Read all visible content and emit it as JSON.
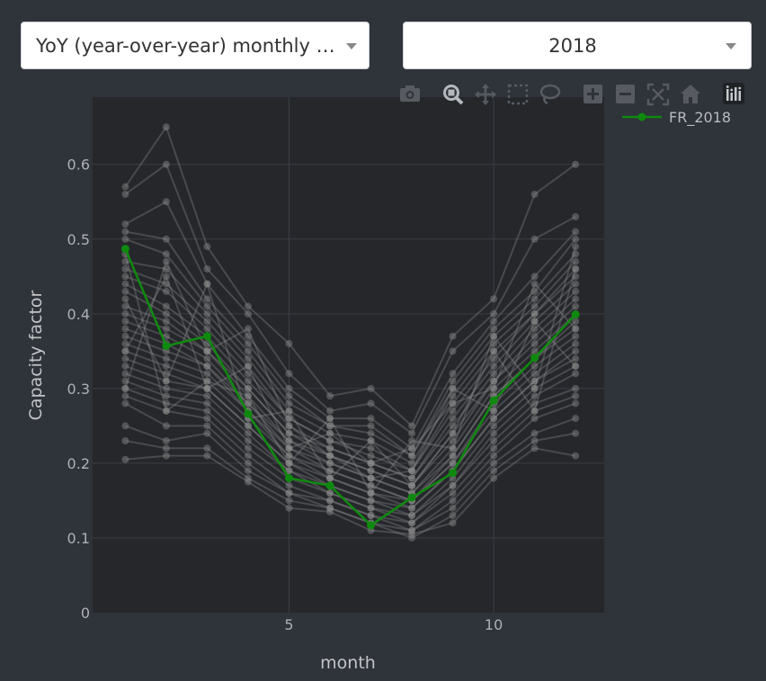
{
  "controls": {
    "metric_dropdown": {
      "selected": "YoY (year-over-year) monthly capacity factor"
    },
    "year_dropdown": {
      "selected": "2018"
    }
  },
  "modebar": {
    "buttons": [
      "camera-icon",
      "zoom-icon",
      "pan-icon",
      "box-select-icon",
      "lasso-icon",
      "zoom-in-icon",
      "zoom-out-icon",
      "autoscale-icon",
      "home-icon",
      "plotly-logo-icon"
    ]
  },
  "colors": {
    "page_bg": "#2f333a",
    "plot_bg": "#25272b",
    "highlight": "#0f8a0f",
    "background_series": "#8c8c8c"
  },
  "chart_data": {
    "type": "line",
    "xlabel": "month",
    "ylabel": "Capacity factor",
    "x": [
      1,
      2,
      3,
      4,
      5,
      6,
      7,
      8,
      9,
      10,
      11,
      12
    ],
    "xlim": [
      0.2,
      12.7
    ],
    "ylim": [
      0,
      0.69
    ],
    "xticks": [
      5,
      10
    ],
    "yticks": [
      0,
      0.1,
      0.2,
      0.3,
      0.4,
      0.5,
      0.6
    ],
    "ytick_labels": [
      "0",
      "0.1",
      "0.2",
      "0.3",
      "0.4",
      "0.5",
      "0.6"
    ],
    "grid": true,
    "legend": {
      "placement": "top-right",
      "entries": [
        "FR_2018"
      ]
    },
    "highlight_series": {
      "name": "FR_2018",
      "values": [
        0.487,
        0.357,
        0.37,
        0.266,
        0.18,
        0.17,
        0.117,
        0.154,
        0.187,
        0.284,
        0.341,
        0.399
      ]
    },
    "background_series": [
      [
        0.57,
        0.65,
        0.49,
        0.41,
        0.36,
        0.29,
        0.3,
        0.25,
        0.37,
        0.42,
        0.56,
        0.6
      ],
      [
        0.56,
        0.6,
        0.46,
        0.4,
        0.32,
        0.27,
        0.28,
        0.24,
        0.35,
        0.4,
        0.5,
        0.53
      ],
      [
        0.52,
        0.55,
        0.44,
        0.37,
        0.3,
        0.26,
        0.26,
        0.22,
        0.32,
        0.39,
        0.45,
        0.51
      ],
      [
        0.51,
        0.5,
        0.42,
        0.36,
        0.29,
        0.25,
        0.25,
        0.21,
        0.31,
        0.38,
        0.43,
        0.5
      ],
      [
        0.5,
        0.48,
        0.41,
        0.35,
        0.28,
        0.25,
        0.24,
        0.21,
        0.3,
        0.37,
        0.42,
        0.48
      ],
      [
        0.47,
        0.46,
        0.4,
        0.34,
        0.27,
        0.24,
        0.23,
        0.2,
        0.29,
        0.36,
        0.41,
        0.47
      ],
      [
        0.46,
        0.44,
        0.39,
        0.33,
        0.26,
        0.23,
        0.22,
        0.19,
        0.28,
        0.35,
        0.4,
        0.46
      ],
      [
        0.45,
        0.43,
        0.38,
        0.32,
        0.26,
        0.23,
        0.21,
        0.19,
        0.27,
        0.34,
        0.4,
        0.45
      ],
      [
        0.44,
        0.41,
        0.37,
        0.31,
        0.25,
        0.22,
        0.2,
        0.18,
        0.26,
        0.33,
        0.39,
        0.44
      ],
      [
        0.43,
        0.4,
        0.36,
        0.3,
        0.24,
        0.22,
        0.2,
        0.18,
        0.25,
        0.32,
        0.38,
        0.43
      ],
      [
        0.41,
        0.39,
        0.35,
        0.3,
        0.24,
        0.21,
        0.19,
        0.17,
        0.24,
        0.31,
        0.37,
        0.42
      ],
      [
        0.4,
        0.38,
        0.35,
        0.29,
        0.23,
        0.21,
        0.19,
        0.17,
        0.23,
        0.31,
        0.36,
        0.41
      ],
      [
        0.39,
        0.37,
        0.34,
        0.28,
        0.23,
        0.2,
        0.18,
        0.16,
        0.22,
        0.3,
        0.35,
        0.4
      ],
      [
        0.38,
        0.36,
        0.33,
        0.28,
        0.22,
        0.2,
        0.18,
        0.16,
        0.21,
        0.29,
        0.34,
        0.39
      ],
      [
        0.37,
        0.35,
        0.33,
        0.27,
        0.22,
        0.19,
        0.17,
        0.15,
        0.21,
        0.29,
        0.34,
        0.38
      ],
      [
        0.36,
        0.34,
        0.32,
        0.27,
        0.21,
        0.19,
        0.17,
        0.15,
        0.2,
        0.28,
        0.33,
        0.37
      ],
      [
        0.35,
        0.33,
        0.31,
        0.26,
        0.21,
        0.18,
        0.16,
        0.15,
        0.2,
        0.27,
        0.32,
        0.36
      ],
      [
        0.34,
        0.32,
        0.3,
        0.25,
        0.2,
        0.18,
        0.16,
        0.14,
        0.19,
        0.26,
        0.31,
        0.35
      ],
      [
        0.33,
        0.31,
        0.3,
        0.25,
        0.2,
        0.17,
        0.15,
        0.14,
        0.19,
        0.26,
        0.31,
        0.34
      ],
      [
        0.32,
        0.3,
        0.29,
        0.24,
        0.19,
        0.17,
        0.15,
        0.13,
        0.18,
        0.25,
        0.3,
        0.33
      ],
      [
        0.31,
        0.29,
        0.28,
        0.23,
        0.19,
        0.16,
        0.14,
        0.13,
        0.17,
        0.24,
        0.29,
        0.32
      ],
      [
        0.3,
        0.28,
        0.27,
        0.22,
        0.18,
        0.16,
        0.14,
        0.12,
        0.17,
        0.23,
        0.28,
        0.3
      ],
      [
        0.29,
        0.27,
        0.26,
        0.21,
        0.17,
        0.15,
        0.13,
        0.12,
        0.16,
        0.22,
        0.27,
        0.29
      ],
      [
        0.28,
        0.25,
        0.25,
        0.2,
        0.16,
        0.15,
        0.13,
        0.11,
        0.15,
        0.21,
        0.26,
        0.28
      ],
      [
        0.25,
        0.23,
        0.24,
        0.19,
        0.16,
        0.14,
        0.12,
        0.11,
        0.14,
        0.2,
        0.24,
        0.26
      ],
      [
        0.23,
        0.22,
        0.22,
        0.18,
        0.15,
        0.14,
        0.12,
        0.1,
        0.13,
        0.19,
        0.23,
        0.24
      ],
      [
        0.205,
        0.21,
        0.21,
        0.175,
        0.14,
        0.135,
        0.11,
        0.105,
        0.12,
        0.18,
        0.22,
        0.21
      ],
      [
        0.35,
        0.45,
        0.3,
        0.33,
        0.22,
        0.24,
        0.2,
        0.22,
        0.28,
        0.3,
        0.44,
        0.38
      ],
      [
        0.42,
        0.31,
        0.44,
        0.26,
        0.27,
        0.18,
        0.23,
        0.17,
        0.24,
        0.35,
        0.27,
        0.46
      ],
      [
        0.3,
        0.47,
        0.35,
        0.38,
        0.25,
        0.21,
        0.18,
        0.19,
        0.3,
        0.27,
        0.39,
        0.33
      ],
      [
        0.48,
        0.27,
        0.31,
        0.29,
        0.2,
        0.26,
        0.16,
        0.23,
        0.22,
        0.37,
        0.3,
        0.49
      ]
    ]
  }
}
